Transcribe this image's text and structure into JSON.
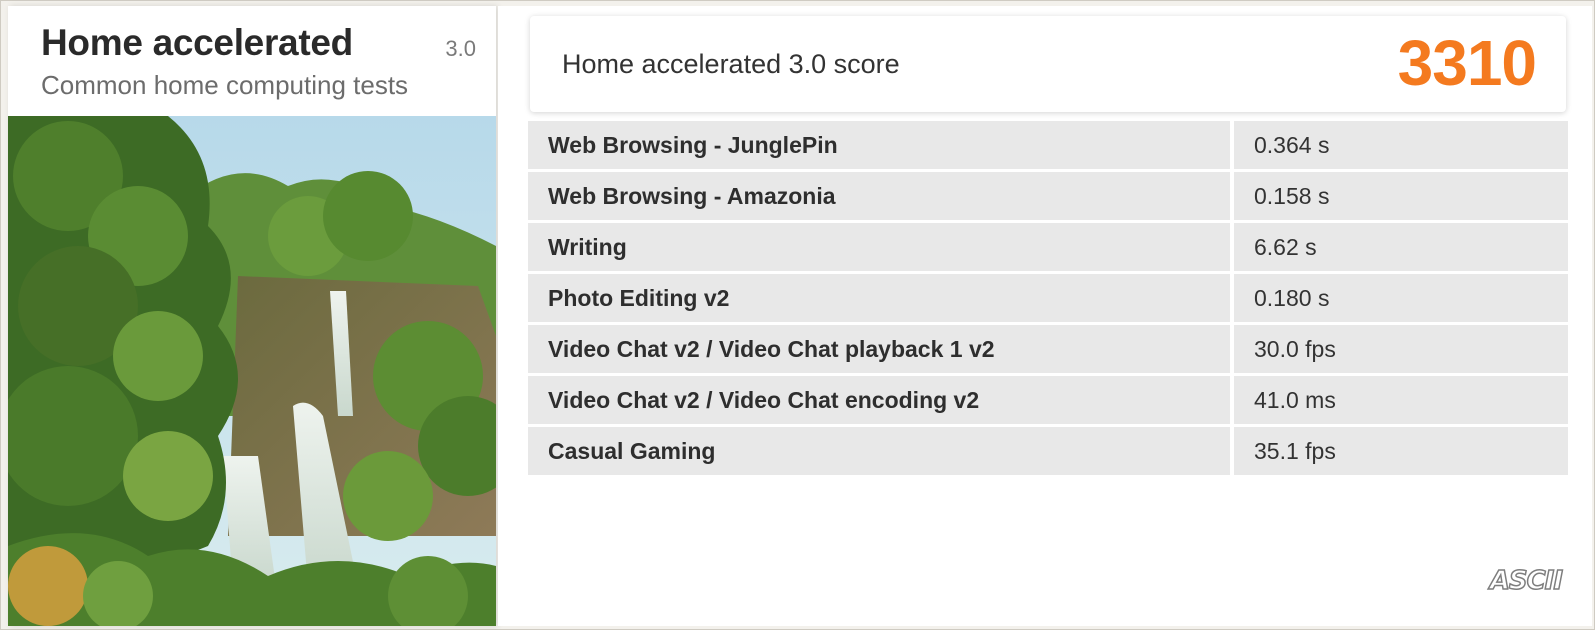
{
  "test": {
    "title": "Home accelerated",
    "version": "3.0",
    "subtitle": "Common home computing tests"
  },
  "score": {
    "label": "Home accelerated 3.0 score",
    "value": "3310",
    "color": "#f47a1f"
  },
  "results": [
    {
      "name": "Web Browsing - JunglePin",
      "value": "0.364 s"
    },
    {
      "name": "Web Browsing - Amazonia",
      "value": "0.158 s"
    },
    {
      "name": "Writing",
      "value": "6.62 s"
    },
    {
      "name": "Photo Editing v2",
      "value": "0.180 s"
    },
    {
      "name": "Video Chat v2 / Video Chat playback 1 v2",
      "value": "30.0 fps"
    },
    {
      "name": "Video Chat v2 / Video Chat encoding v2",
      "value": "41.0 ms"
    },
    {
      "name": "Casual Gaming",
      "value": "35.1 fps"
    }
  ],
  "watermark": "ASCII",
  "hero_image": "waterfall-jungle-photo"
}
